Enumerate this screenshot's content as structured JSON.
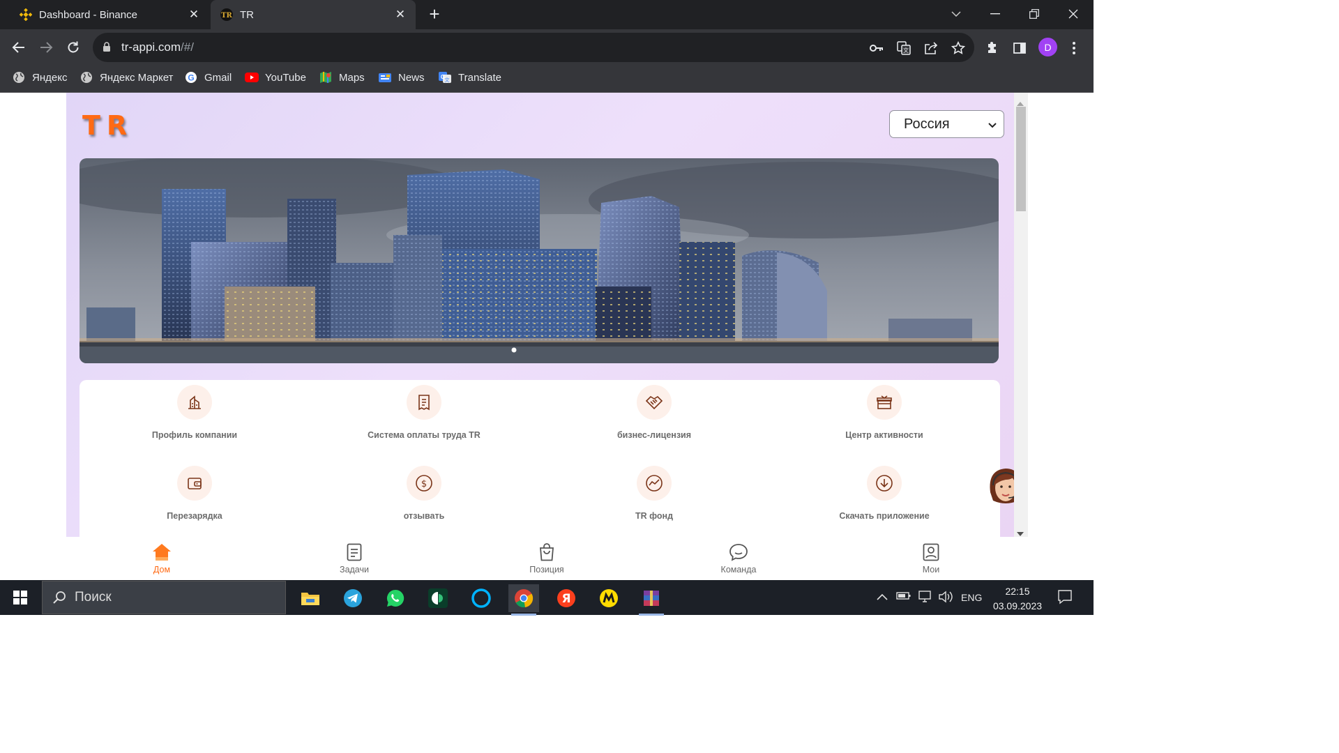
{
  "browser": {
    "tabs": [
      {
        "title": "Dashboard - Binance",
        "icon": "binance-icon",
        "active": false
      },
      {
        "title": "TR",
        "icon": "tr-logo-icon",
        "active": true
      }
    ],
    "address": {
      "host": "tr-appi.com",
      "path": "/#/"
    },
    "profile_initial": "D",
    "bookmarks": [
      {
        "label": "Яндекс",
        "icon": "globe-icon"
      },
      {
        "label": "Яндекс Маркет",
        "icon": "globe-icon"
      },
      {
        "label": "Gmail",
        "icon": "google-icon"
      },
      {
        "label": "YouTube",
        "icon": "youtube-icon"
      },
      {
        "label": "Maps",
        "icon": "maps-icon"
      },
      {
        "label": "News",
        "icon": "news-icon"
      },
      {
        "label": "Translate",
        "icon": "translate-icon"
      }
    ]
  },
  "site": {
    "logo_text": "TR",
    "country_select": {
      "selected": "Россия"
    },
    "carousel": {
      "slide_count": 1,
      "active_index": 0
    },
    "services": [
      {
        "label": "Профиль компании",
        "icon": "building-icon"
      },
      {
        "label": "Система оплаты труда TR",
        "icon": "receipt-icon"
      },
      {
        "label": "бизнес-лицензия",
        "icon": "handshake-icon"
      },
      {
        "label": "Центр активности",
        "icon": "gift-icon"
      },
      {
        "label": "Перезарядка",
        "icon": "wallet-icon"
      },
      {
        "label": "отзывать",
        "icon": "dollar-icon"
      },
      {
        "label": "TR фонд",
        "icon": "trend-icon"
      },
      {
        "label": "Скачать приложение",
        "icon": "download-icon"
      }
    ],
    "bottom_nav": [
      {
        "label": "Дом",
        "icon": "home-icon",
        "active": true
      },
      {
        "label": "Задачи",
        "icon": "tasks-icon",
        "active": false
      },
      {
        "label": "Позиция",
        "icon": "bag-icon",
        "active": false
      },
      {
        "label": "Команда",
        "icon": "chat-icon",
        "active": false
      },
      {
        "label": "Мои",
        "icon": "profile-icon",
        "active": false
      }
    ]
  },
  "taskbar": {
    "search_placeholder": "Поиск",
    "language": "ENG",
    "time": "22:15",
    "date": "03.09.2023"
  },
  "colors": {
    "accent": "#ff6a14",
    "icon_stroke": "#7a3418",
    "icon_bg": "#fdf0ea"
  }
}
